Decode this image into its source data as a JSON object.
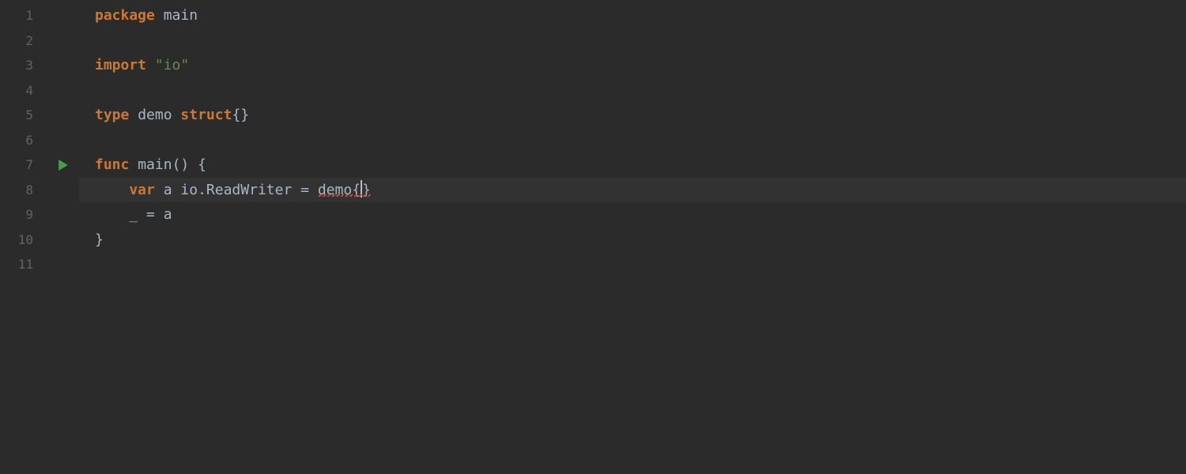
{
  "lineNumbers": [
    "1",
    "2",
    "3",
    "4",
    "5",
    "6",
    "7",
    "8",
    "9",
    "10",
    "11"
  ],
  "runIconLine": 7,
  "currentLine": 8,
  "kw": {
    "package": "package",
    "import": "import",
    "type": "type",
    "struct": "struct",
    "func": "func",
    "var": "var"
  },
  "code": {
    "pkgName": "main",
    "importPath": "\"io\"",
    "typeName": "demo",
    "structBraces": "{}",
    "funcName": "main",
    "parens": "()",
    "openBrace": "{",
    "closeBrace": "}",
    "varName": "a",
    "ioPkg": "io",
    "dot": ".",
    "readWriter": "ReadWriter",
    "eq": "=",
    "demoLit": "demo",
    "litOpen": "{",
    "litClose": "}",
    "blank": "_",
    "eq2": "=",
    "aRef": "a"
  }
}
